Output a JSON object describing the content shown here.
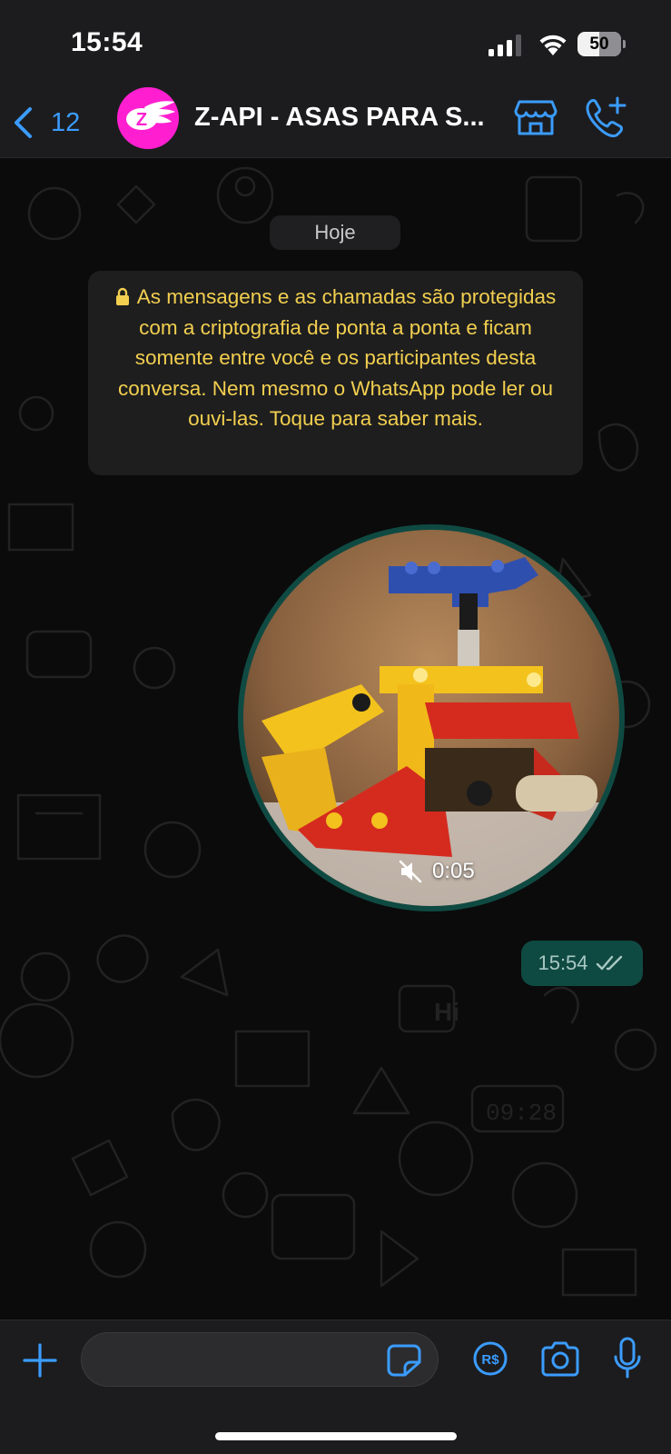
{
  "status_bar": {
    "time": "15:54",
    "battery_percent": "50",
    "battery_level": 0.5,
    "icons": [
      "signal-icon",
      "wifi-icon",
      "battery-icon"
    ]
  },
  "header": {
    "back_count": "12",
    "contact_name": "Z-API - ASAS PARA S...",
    "avatar_text": "Z",
    "icons": [
      "back-chevron-icon",
      "store-icon",
      "call-add-icon"
    ]
  },
  "chat": {
    "date_chip": "Hoje",
    "encryption_notice": "As mensagens e as chamadas são protegidas com a criptografia de ponta a ponta e ficam somente entre você e os participantes desta conversa. Nem mesmo o WhatsApp pode ler ou ouvi-las. Toque para saber mais.",
    "video_note": {
      "duration": "0:05",
      "muted": true
    },
    "message_time": "15:54",
    "read_status": "read"
  },
  "input_bar": {
    "placeholder": "",
    "icons": [
      "plus-icon",
      "sticker-icon",
      "payment-icon",
      "camera-icon",
      "mic-icon"
    ]
  },
  "colors": {
    "accent_blue": "#3b9cff",
    "avatar_pink": "#ff1fd0",
    "notice_yellow": "#f2cf4f",
    "outgoing_bubble": "#0f4a42",
    "background": "#0b0b0b",
    "bar_background": "#1c1c1e"
  }
}
